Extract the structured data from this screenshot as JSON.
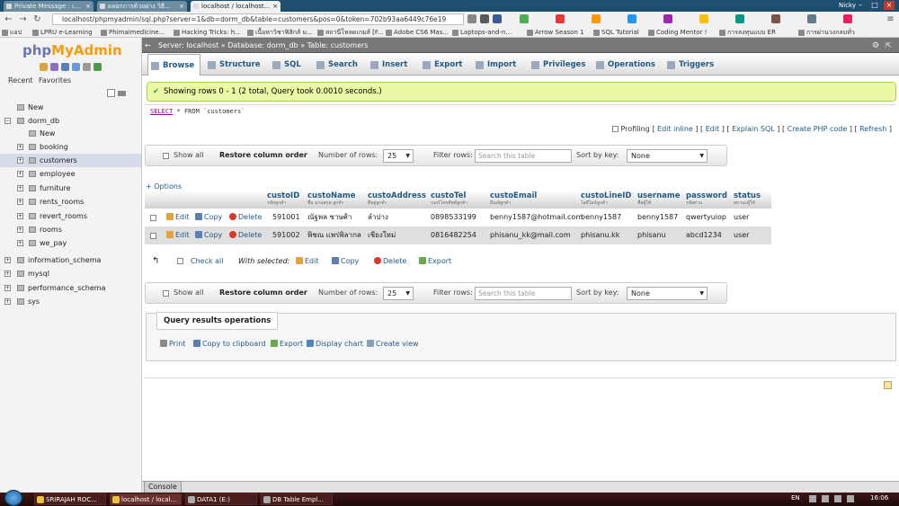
{
  "browser": {
    "tabs": [
      {
        "label": "Private Message : เ...",
        "active": false
      },
      {
        "label": "ผลยกการด้วยฝาง วิธี...",
        "active": false
      },
      {
        "label": "localhost / localhost...",
        "active": true
      }
    ],
    "user": "Nicky",
    "url": "localhost/phpmyadmin/sql.php?server=1&db=dorm_db&table=customers&pos=0&token=702b93aa6449c76e19",
    "bookmarks": [
      "แอป",
      "LPRU e-Learning",
      "Phimaimedicine...",
      "Hacking Tricks: h...",
      "เนื้อหาวิชาฟิสิกส์ ม...",
      "สถานีโหลดเกมส์ [F...",
      "Adobe CS6 Mas...",
      "Laptops-and-n...",
      "Arrow Season 1",
      "SQL Tutorial",
      "Coding Mentor !",
      "การลงทุนแบบ ER",
      "การผ่านวงกลมทั่ว"
    ]
  },
  "sidebar": {
    "logo_main": "php",
    "logo_accent": "MyAdmin",
    "recent": "Recent",
    "favorites": "Favorites",
    "tree": [
      {
        "label": "New",
        "level": 0,
        "selected": false
      },
      {
        "label": "dorm_db",
        "level": 0,
        "selected": false
      },
      {
        "label": "New",
        "level": 1,
        "selected": false
      },
      {
        "label": "booking",
        "level": 1,
        "selected": false
      },
      {
        "label": "customers",
        "level": 1,
        "selected": true
      },
      {
        "label": "employee",
        "level": 1,
        "selected": false
      },
      {
        "label": "furniture",
        "level": 1,
        "selected": false
      },
      {
        "label": "rents_rooms",
        "level": 1,
        "selected": false
      },
      {
        "label": "revert_rooms",
        "level": 1,
        "selected": false
      },
      {
        "label": "rooms",
        "level": 1,
        "selected": false
      },
      {
        "label": "we_pay",
        "level": 1,
        "selected": false
      },
      {
        "label": "information_schema",
        "level": 0,
        "selected": false
      },
      {
        "label": "mysql",
        "level": 0,
        "selected": false
      },
      {
        "label": "performance_schema",
        "level": 0,
        "selected": false
      },
      {
        "label": "sys",
        "level": 0,
        "selected": false
      }
    ]
  },
  "breadcrumb": {
    "server": "Server: localhost",
    "database": "Database: dorm_db",
    "table": "Table: customers"
  },
  "menu": [
    "Browse",
    "Structure",
    "SQL",
    "Search",
    "Insert",
    "Export",
    "Import",
    "Privileges",
    "Operations",
    "Triggers"
  ],
  "result": {
    "message": "Showing rows 0 - 1 (2 total, Query took 0.0010 seconds.)",
    "sql_keyword": "SELECT",
    "sql_rest": " * FROM `customers`"
  },
  "profiling": {
    "label": "Profiling",
    "links": [
      "Edit inline",
      "Edit",
      "Explain SQL",
      "Create PHP code",
      "Refresh"
    ]
  },
  "nav": {
    "show_all": "Show all",
    "restore": "Restore column order",
    "rows_label": "Number of rows:",
    "rows_value": "25",
    "filter_label": "Filter rows:",
    "filter_placeholder": "Search this table",
    "sort_label": "Sort by key:",
    "sort_value": "None"
  },
  "options_label": "+ Options",
  "columns": [
    {
      "name": "custoID",
      "comment": "รหัสลูกค้า"
    },
    {
      "name": "custoName",
      "comment": "ชื่อ นามสกุล ลูกค้า"
    },
    {
      "name": "custoAddress",
      "comment": "ที่อยู่ลูกค้า"
    },
    {
      "name": "custoTel",
      "comment": "เบอร์โทรศัพท์ลูกค้า"
    },
    {
      "name": "custoEmail",
      "comment": "อีเมล์ลูกค้า"
    },
    {
      "name": "custoLineID",
      "comment": "ไอดีไลน์ลูกค้า"
    },
    {
      "name": "username",
      "comment": "ชื่อผู้ใช้"
    },
    {
      "name": "password",
      "comment": "รหัสผ่าน"
    },
    {
      "name": "status",
      "comment": "สถานะผู้ใช้"
    }
  ],
  "row_actions": {
    "edit": "Edit",
    "copy": "Copy",
    "delete": "Delete"
  },
  "rows": [
    [
      "591001",
      "ณัฐพล ชาษศ้า",
      "ลำปาง",
      "0898533199",
      "benny1587@hotmail.com",
      "benny1587",
      "benny1587",
      "qwertyuiop",
      "user"
    ],
    [
      "591002",
      "พิชณ แพร่พิลากล",
      "เชียงใหม่",
      "0816482254",
      "phisanu_kk@mail.com",
      "phisanu.kk",
      "phisanu",
      "abcd1234",
      "user"
    ]
  ],
  "with_selected": {
    "check_all": "Check all",
    "label": "With selected:",
    "edit": "Edit",
    "copy": "Copy",
    "delete": "Delete",
    "export": "Export"
  },
  "qro": {
    "title": "Query results operations",
    "links": [
      "Print",
      "Copy to clipboard",
      "Export",
      "Display chart",
      "Create view"
    ]
  },
  "console_label": "Console",
  "taskbar": {
    "items": [
      "SRIRAJAH ROC...",
      "localhost / local...",
      "DATA1 (E:)",
      "DB Table Empl..."
    ],
    "lang": "EN",
    "clock": "16:06"
  },
  "colors": {
    "link": "#235a81",
    "success_bg": "#ebf8a4",
    "selected_row": "#d6dbe9"
  }
}
